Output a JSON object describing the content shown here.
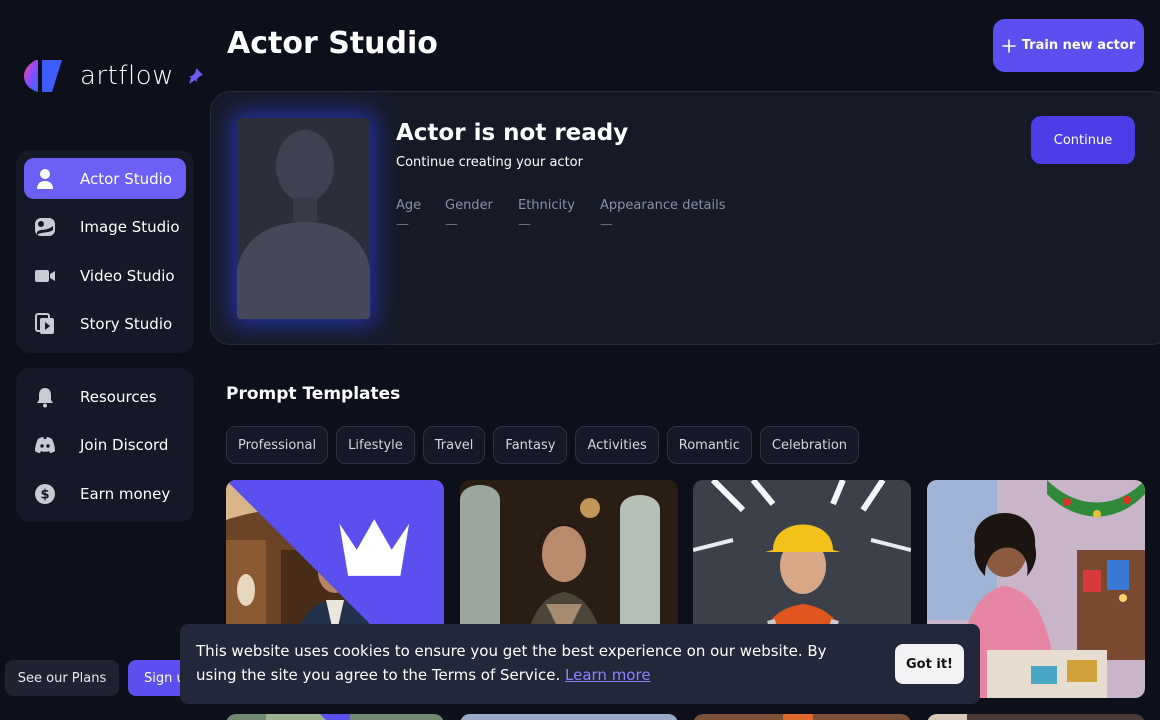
{
  "brand": {
    "name": "artflow"
  },
  "sidebar": {
    "main_items": [
      {
        "label": "Actor Studio",
        "icon": "user-icon",
        "active": true
      },
      {
        "label": "Image Studio",
        "icon": "image-icon",
        "active": false
      },
      {
        "label": "Video Studio",
        "icon": "video-camera-icon",
        "active": false
      },
      {
        "label": "Story Studio",
        "icon": "story-icon",
        "active": false
      }
    ],
    "secondary_items": [
      {
        "label": "Resources",
        "icon": "bell-icon"
      },
      {
        "label": "Join Discord",
        "icon": "discord-icon"
      },
      {
        "label": "Earn money",
        "icon": "dollar-coin-icon"
      }
    ],
    "plans_label": "See our Plans",
    "signup_label": "Sign up"
  },
  "header": {
    "title": "Actor Studio",
    "train_label": "Train new actor"
  },
  "actor_card": {
    "title": "Actor is not ready",
    "subtitle": "Continue creating your actor",
    "continue_label": "Continue",
    "attributes": [
      {
        "label": "Age",
        "value": "—"
      },
      {
        "label": "Gender",
        "value": "—"
      },
      {
        "label": "Ethnicity",
        "value": "—"
      },
      {
        "label": "Appearance details",
        "value": "—"
      }
    ]
  },
  "templates": {
    "title": "Prompt Templates",
    "categories": [
      "Professional",
      "Lifestyle",
      "Travel",
      "Fantasy",
      "Activities",
      "Romantic",
      "Celebration"
    ]
  },
  "cookie": {
    "text": "This website uses cookies to ensure you get the best experience on our website. By using the site you agree to the Terms of Service.",
    "link_label": "Learn more",
    "button_label": "Got it!"
  },
  "colors": {
    "accent": "#5b4ff0",
    "active_nav": "#6b5ff5",
    "background": "#0d0f1a",
    "panel": "#151826"
  }
}
